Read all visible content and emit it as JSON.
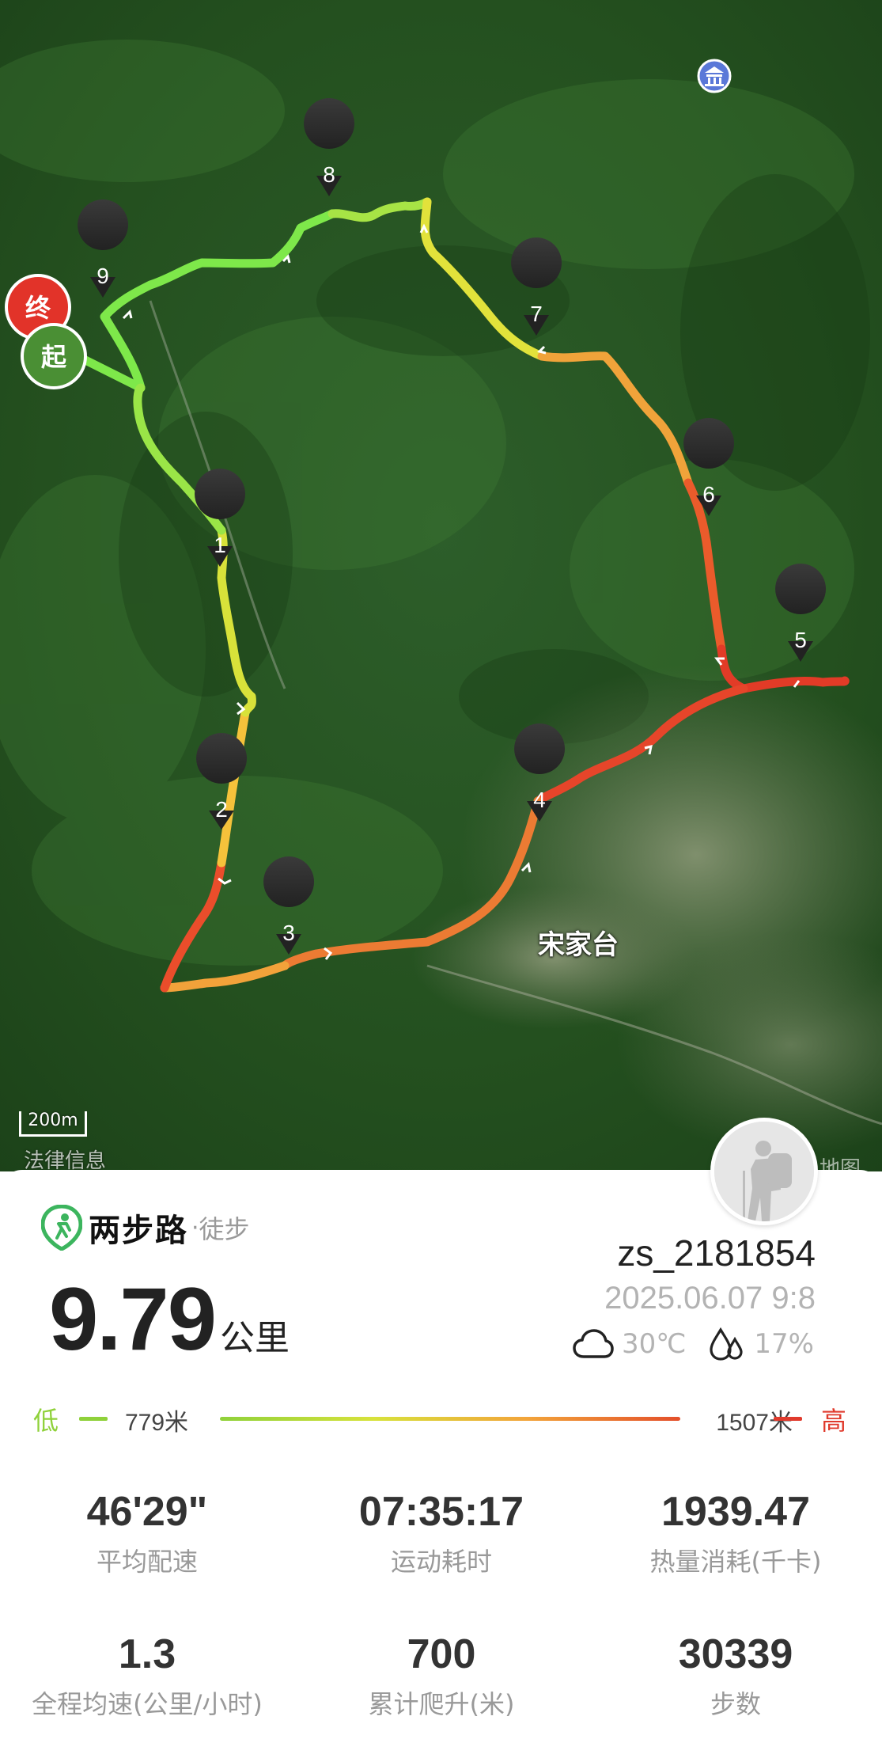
{
  "map": {
    "place_name": "宋家台",
    "scale_label": "200m",
    "legal_link": "法律信息",
    "watermark": "地图",
    "start_marker": "起",
    "end_marker": "终",
    "waypoints": [
      "1",
      "2",
      "3",
      "4",
      "5",
      "6",
      "7",
      "8",
      "9"
    ],
    "icons": {
      "poi": "temple-icon"
    }
  },
  "brand": {
    "name": "两步路",
    "separator": "·",
    "activity_type": "徒步",
    "accent_color": "#3cb55e"
  },
  "summary": {
    "distance_value": "9.79",
    "distance_unit": "公里",
    "username": "zs_2181854",
    "datetime": "2025.06.07 9:8",
    "temperature": "30℃",
    "humidity": "17%"
  },
  "elevation": {
    "low_label": "低",
    "low_value": "779米",
    "high_value": "1507米",
    "high_label": "高",
    "low_color": "#8fd13a",
    "high_color": "#e03a2c"
  },
  "stats": [
    {
      "value": "46'29\"",
      "label": "平均配速"
    },
    {
      "value": "07:35:17",
      "label": "运动耗时"
    },
    {
      "value": "1939.47",
      "label": "热量消耗(千卡)"
    },
    {
      "value": "1.3",
      "label": "全程均速(公里/小时)"
    },
    {
      "value": "700",
      "label": "累计爬升(米)"
    },
    {
      "value": "30339",
      "label": "步数"
    }
  ]
}
